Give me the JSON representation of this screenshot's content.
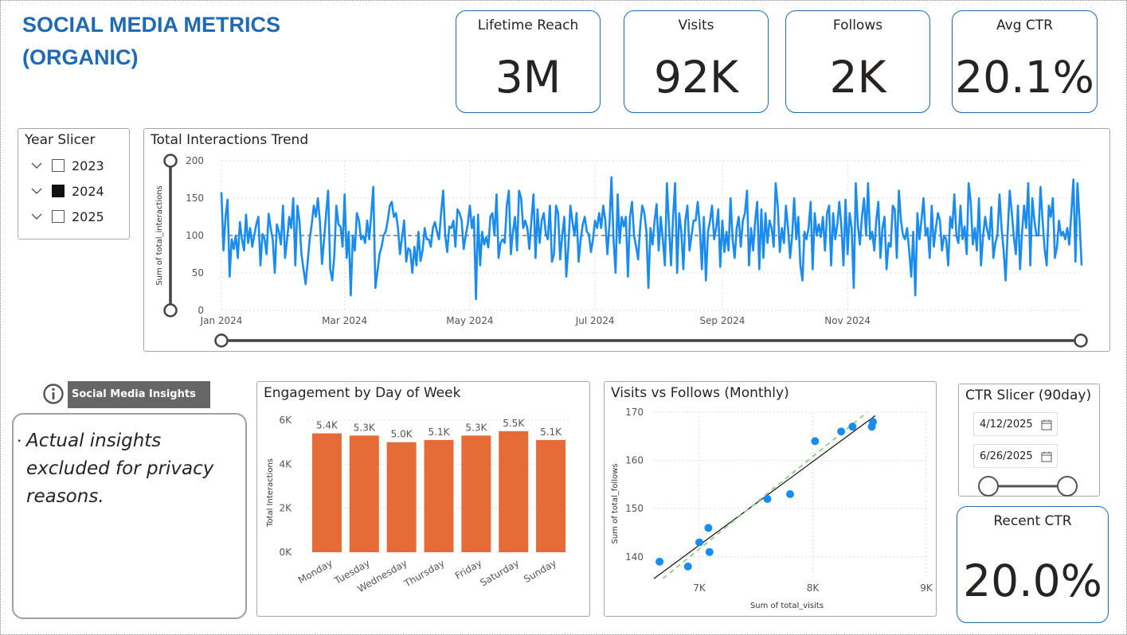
{
  "title_line1": "SOCIAL MEDIA METRICS",
  "title_line2": "(ORGANIC)",
  "kpis": [
    {
      "label": "Lifetime Reach",
      "value": "3M"
    },
    {
      "label": "Visits",
      "value": "92K"
    },
    {
      "label": "Follows",
      "value": "2K"
    },
    {
      "label": "Avg CTR",
      "value": "20.1%"
    }
  ],
  "year_slicer": {
    "title": "Year Slicer",
    "items": [
      {
        "label": "2023",
        "checked": false
      },
      {
        "label": "2024",
        "checked": true
      },
      {
        "label": "2025",
        "checked": false
      }
    ]
  },
  "insights": {
    "button_label": "Social Media Insights",
    "icon": "info-icon",
    "text": "Actual insights excluded for privacy reasons."
  },
  "ctr_slicer": {
    "title": "CTR Slicer (90day)",
    "start_date": "4/12/2025",
    "end_date": "6/26/2025"
  },
  "recent_ctr": {
    "label": "Recent CTR",
    "value": "20.0%"
  },
  "colors": {
    "brand_blue": "#1f6ab2",
    "line_blue": "#1a8cf0",
    "bar_orange": "#e66c37",
    "trend_green": "#94d28b"
  },
  "chart_data": [
    {
      "type": "line",
      "title": "Total Interactions Trend",
      "ylabel": "Sum of total_interactions",
      "ylim": [
        0,
        200
      ],
      "yticks": [
        "0",
        "50",
        "100",
        "150",
        "200"
      ],
      "xticks": [
        "Jan 2024",
        "Mar 2024",
        "May 2024",
        "Jul 2024",
        "Sep 2024",
        "Nov 2024"
      ],
      "x_start": "2024-01-01",
      "reference_line": 100,
      "grid": true,
      "values": [
        158,
        80,
        125,
        148,
        45,
        95,
        82,
        100,
        70,
        118,
        95,
        80,
        128,
        90,
        110,
        85,
        100,
        115,
        125,
        60,
        102,
        96,
        75,
        129,
        110,
        95,
        50,
        115,
        105,
        88,
        140,
        70,
        95,
        125,
        110,
        150,
        60,
        140,
        120,
        75,
        55,
        35,
        65,
        95,
        115,
        140,
        125,
        150,
        118,
        62,
        95,
        130,
        160,
        55,
        40,
        75,
        140,
        115,
        112,
        85,
        155,
        70,
        105,
        20,
        100,
        80,
        130,
        120,
        95,
        100,
        90,
        120,
        95,
        130,
        165,
        30,
        52,
        75,
        85,
        100,
        105,
        120,
        140,
        145,
        125,
        130,
        110,
        75,
        98,
        120,
        65,
        83,
        80,
        50,
        85,
        60,
        105,
        66,
        80,
        110,
        95,
        95,
        85,
        110,
        118,
        105,
        95,
        130,
        160,
        100,
        78,
        112,
        110,
        120,
        85,
        135,
        130,
        120,
        82,
        100,
        115,
        140,
        110,
        125,
        15,
        128,
        60,
        105,
        88,
        98,
        84,
        125,
        130,
        100,
        155,
        70,
        90,
        95,
        90,
        140,
        160,
        75,
        105,
        125,
        80,
        160,
        150,
        110,
        120,
        110,
        82,
        120,
        155,
        70,
        135,
        90,
        120,
        130,
        102,
        95,
        140,
        65,
        75,
        140,
        130,
        68,
        100,
        125,
        45,
        85,
        140,
        118,
        100,
        130,
        65,
        95,
        115,
        125,
        105,
        102,
        78,
        95,
        120,
        110,
        130,
        110,
        140,
        120,
        75,
        115,
        178,
        95,
        50,
        155,
        90,
        125,
        112,
        125,
        45,
        125,
        145,
        100,
        85,
        68,
        112,
        140,
        130,
        105,
        30,
        110,
        88,
        120,
        142,
        80,
        125,
        95,
        60,
        170,
        115,
        60,
        125,
        170,
        50,
        130,
        105,
        55,
        120,
        140,
        80,
        100,
        120,
        120,
        145,
        112,
        55,
        125,
        40,
        105,
        120,
        140,
        95,
        110,
        135,
        58,
        120,
        78,
        105,
        80,
        150,
        95,
        70,
        110,
        125,
        85,
        120,
        130,
        160,
        60,
        110,
        80,
        120,
        145,
        55,
        135,
        70,
        130,
        90,
        120,
        110,
        85,
        170,
        140,
        78,
        110,
        90,
        140,
        110,
        70,
        100,
        150,
        95,
        125,
        60,
        40,
        105,
        95,
        110,
        145,
        55,
        130,
        100,
        115,
        98,
        125,
        80,
        130,
        140,
        60,
        130,
        95,
        115,
        145,
        112,
        60,
        148,
        75,
        130,
        110,
        30,
        170,
        115,
        88,
        125,
        150,
        100,
        170,
        95,
        105,
        80,
        120,
        145,
        70,
        110,
        125,
        55,
        90,
        85,
        140,
        135,
        70,
        160,
        120,
        100,
        95,
        110,
        80,
        45,
        105,
        20,
        130,
        95,
        120,
        150,
        100,
        110,
        70,
        140,
        85,
        110,
        130,
        120,
        80,
        100,
        95,
        60,
        125,
        110,
        155,
        100,
        90,
        140,
        95,
        112,
        75,
        170,
        145,
        88,
        110,
        80,
        150,
        60,
        100,
        125,
        108,
        95,
        138,
        70,
        90,
        100,
        155,
        110,
        80,
        40,
        105,
        160,
        130,
        98,
        75,
        140,
        55,
        105,
        140,
        110,
        170,
        60,
        150,
        120,
        100,
        100,
        165,
        120,
        82,
        60,
        140,
        125,
        150,
        70,
        85,
        120,
        100,
        105,
        95,
        110,
        88,
        130,
        175,
        65,
        170,
        120,
        60
      ]
    },
    {
      "type": "bar",
      "title": "Engagement by Day of Week",
      "ylabel": "Total Interactions",
      "ylim": [
        0,
        6000
      ],
      "yticks": [
        "0K",
        "2K",
        "4K",
        "6K"
      ],
      "categories": [
        "Monday",
        "Tuesday",
        "Wednesday",
        "Thursday",
        "Friday",
        "Saturday",
        "Sunday"
      ],
      "values": [
        5400,
        5300,
        5000,
        5100,
        5300,
        5500,
        5100
      ],
      "data_labels": [
        "5.4K",
        "5.3K",
        "5.0K",
        "5.1K",
        "5.3K",
        "5.5K",
        "5.1K"
      ]
    },
    {
      "type": "scatter",
      "title": "Visits vs Follows (Monthly)",
      "xlabel": "Sum of total_visits",
      "ylabel": "Sum of total_follows",
      "xlim": [
        6600,
        9000
      ],
      "ylim": [
        136,
        170
      ],
      "xticks": [
        "7K",
        "8K",
        "9K"
      ],
      "yticks": [
        "140",
        "150",
        "160",
        "170"
      ],
      "x": [
        6650,
        6900,
        7000,
        7080,
        7090,
        7600,
        7800,
        8020,
        8250,
        8350,
        8520,
        8530
      ],
      "y": [
        139,
        138,
        143,
        146,
        141,
        152,
        153,
        164,
        166,
        167,
        167,
        168
      ]
    }
  ]
}
